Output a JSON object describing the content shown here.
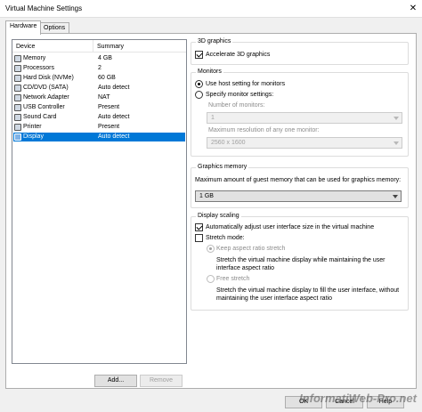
{
  "window": {
    "title": "Virtual Machine Settings",
    "close_glyph": "✕"
  },
  "tabs": [
    {
      "label": "Hardware",
      "active": true
    },
    {
      "label": "Options",
      "active": false
    }
  ],
  "device_list": {
    "headers": {
      "device": "Device",
      "summary": "Summary"
    },
    "rows": [
      {
        "device": "Memory",
        "summary": "4 GB",
        "icon": "memory-icon",
        "selected": false
      },
      {
        "device": "Processors",
        "summary": "2",
        "icon": "processor-icon",
        "selected": false
      },
      {
        "device": "Hard Disk (NVMe)",
        "summary": "60 GB",
        "icon": "hard-disk-icon",
        "selected": false
      },
      {
        "device": "CD/DVD (SATA)",
        "summary": "Auto detect",
        "icon": "cd-dvd-icon",
        "selected": false
      },
      {
        "device": "Network Adapter",
        "summary": "NAT",
        "icon": "network-adapter-icon",
        "selected": false
      },
      {
        "device": "USB Controller",
        "summary": "Present",
        "icon": "usb-controller-icon",
        "selected": false
      },
      {
        "device": "Sound Card",
        "summary": "Auto detect",
        "icon": "sound-card-icon",
        "selected": false
      },
      {
        "device": "Printer",
        "summary": "Present",
        "icon": "printer-icon",
        "selected": false
      },
      {
        "device": "Display",
        "summary": "Auto detect",
        "icon": "display-icon",
        "selected": true
      }
    ],
    "add_label": "Add...",
    "remove_label": "Remove"
  },
  "graphics_3d": {
    "title": "3D graphics",
    "accelerate_label": "Accelerate 3D graphics",
    "accelerate_checked": true
  },
  "monitors": {
    "title": "Monitors",
    "use_host_label": "Use host setting for monitors",
    "specify_label": "Specify monitor settings:",
    "number_label": "Number of monitors:",
    "number_value": "1",
    "max_resolution_label": "Maximum resolution of any one monitor:",
    "max_resolution_value": "2560 x 1600"
  },
  "graphics_memory": {
    "title": "Graphics memory",
    "label": "Maximum amount of guest memory that can be used for graphics memory:",
    "value": "1 GB"
  },
  "display_scaling": {
    "title": "Display scaling",
    "auto_adjust_label": "Automatically adjust user interface size in the virtual machine",
    "auto_adjust_checked": true,
    "stretch_mode_label": "Stretch mode:",
    "stretch_mode_checked": false,
    "keep_aspect_label": "Keep aspect ratio stretch",
    "keep_aspect_desc": "Stretch the virtual machine display while maintaining the user interface aspect ratio",
    "free_stretch_label": "Free stretch",
    "free_stretch_desc": "Stretch the virtual machine display to fill the user interface, without maintaining the user interface aspect ratio"
  },
  "footer": {
    "ok_label": "OK",
    "cancel_label": "Cancel",
    "help_label": "Help"
  },
  "watermark": "InformatiWeb-Pro.net",
  "colors": {
    "selection": "#0078d7",
    "background": "#f0f0f0"
  }
}
